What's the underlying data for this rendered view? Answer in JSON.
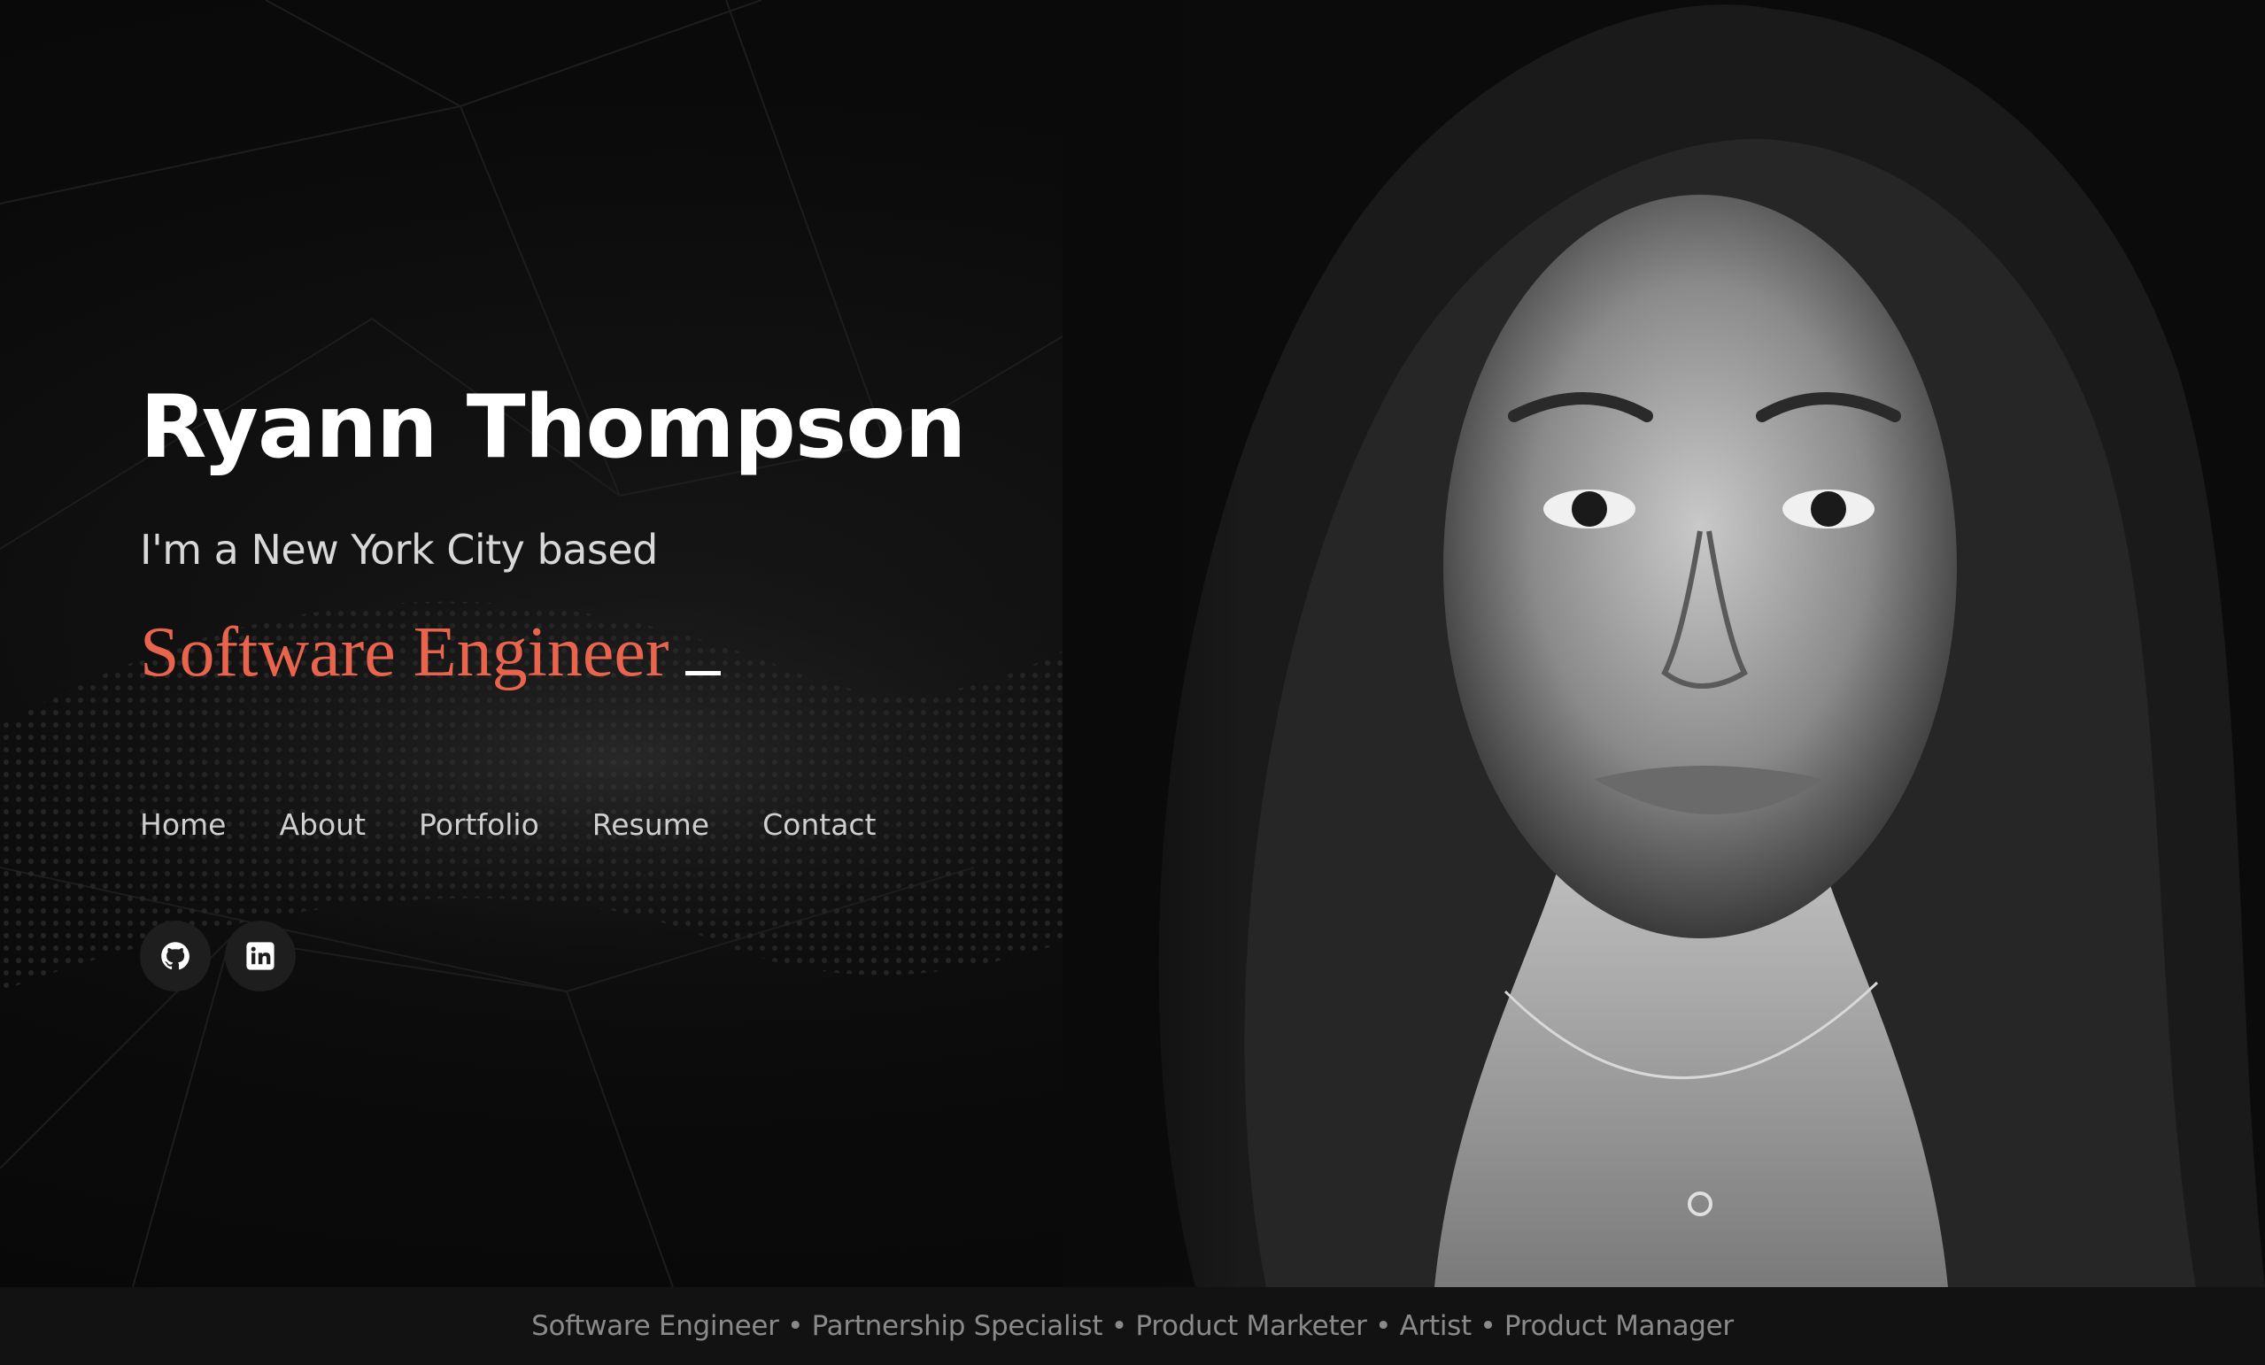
{
  "hero": {
    "name": "Ryann Thompson",
    "intro": "I'm a New York City based",
    "role": "Software Engineer",
    "accent_color": "#e8644d"
  },
  "nav": {
    "items": [
      {
        "label": "Home"
      },
      {
        "label": "About"
      },
      {
        "label": "Portfolio"
      },
      {
        "label": "Resume"
      },
      {
        "label": "Contact"
      }
    ]
  },
  "socials": [
    {
      "icon": "github-icon"
    },
    {
      "icon": "linkedin-icon"
    }
  ],
  "footer": {
    "roles": "Software Engineer • Partnership Specialist • Product Marketer • Artist • Product Manager"
  }
}
